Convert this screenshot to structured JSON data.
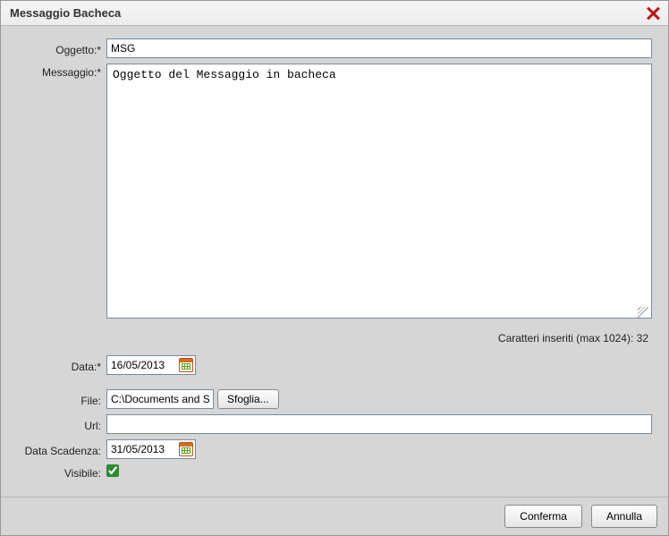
{
  "dialog": {
    "title": "Messaggio Bacheca"
  },
  "labels": {
    "oggetto": "Oggetto:*",
    "messaggio": "Messaggio:*",
    "data": "Data:*",
    "file": "File:",
    "url": "Url:",
    "data_scadenza": "Data Scadenza:",
    "visibile": "Visibile:"
  },
  "fields": {
    "oggetto_value": "MSG",
    "messaggio_value": "Oggetto del Messaggio in bacheca",
    "data_value": "16/05/2013",
    "file_value": "C:\\Documents and Se",
    "url_value": "",
    "data_scadenza_value": "31/05/2013",
    "visibile_checked": true
  },
  "status": {
    "char_count_text": "Caratteri inseriti (max 1024): 32"
  },
  "buttons": {
    "browse": "Sfoglia...",
    "confirm": "Conferma",
    "cancel": "Annulla"
  }
}
